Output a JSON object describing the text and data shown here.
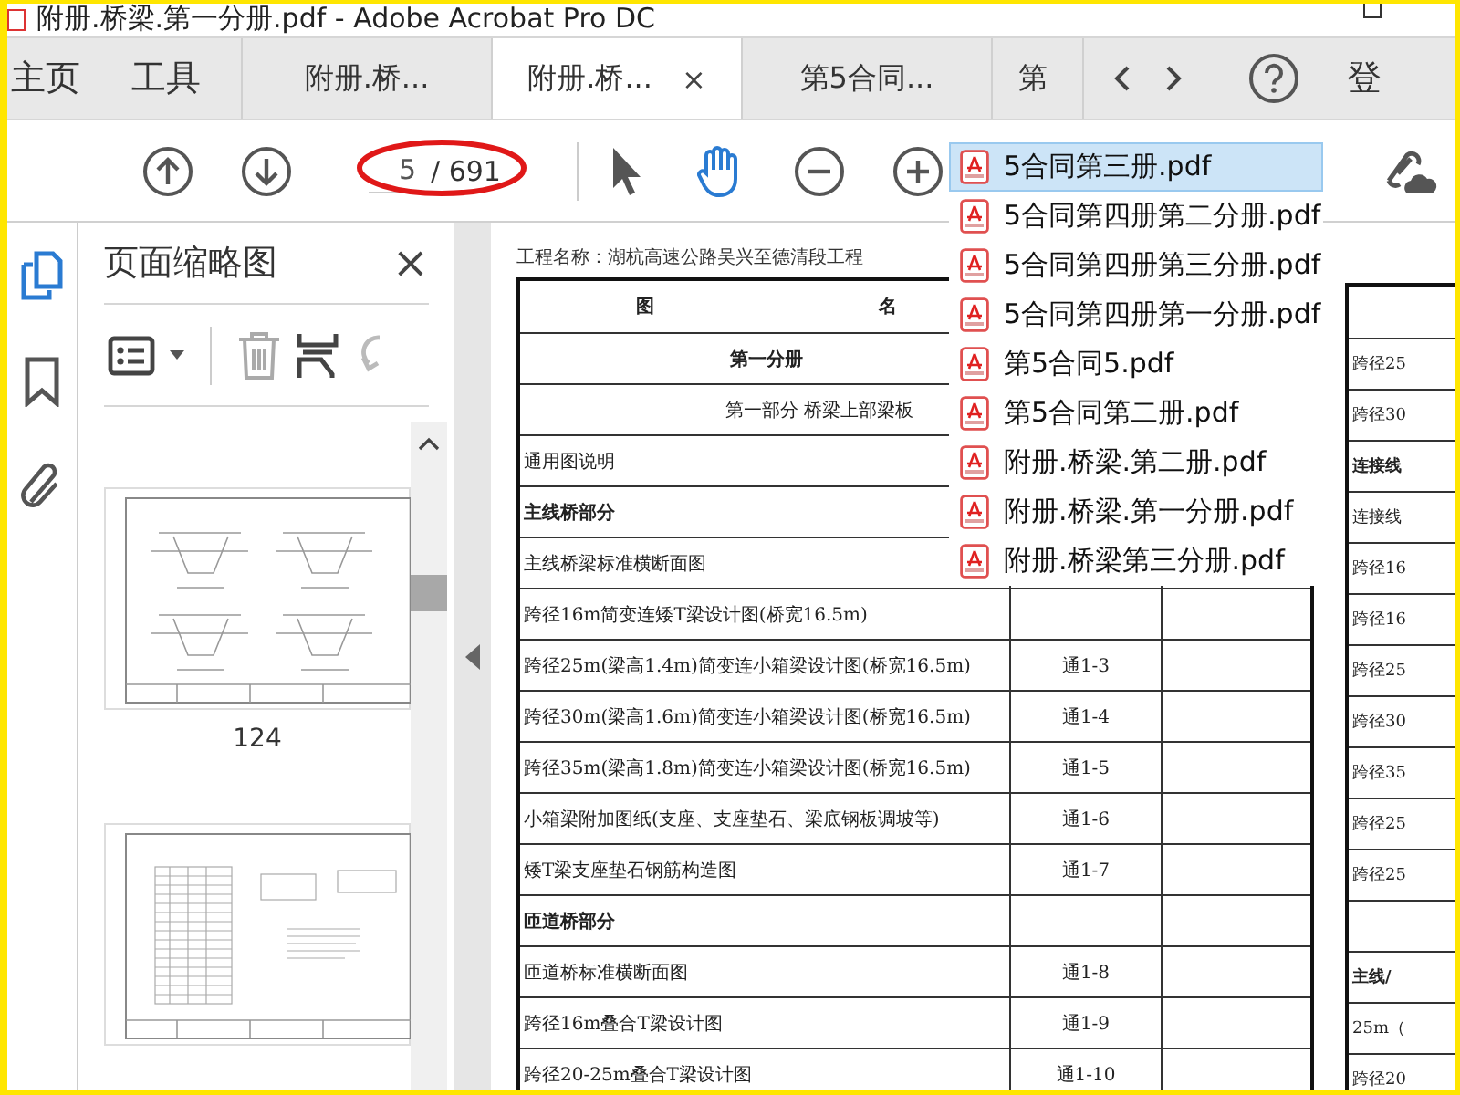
{
  "window": {
    "title": "附册.桥梁.第一分册.pdf - Adobe Acrobat Pro DC"
  },
  "tabs": [
    {
      "label": "主页",
      "kind": "nav",
      "selected": false
    },
    {
      "label": "工具",
      "kind": "nav",
      "selected": false
    },
    {
      "label": "附册.桥...",
      "kind": "doc",
      "selected": false
    },
    {
      "label": "附册.桥...",
      "kind": "doc",
      "selected": true,
      "close": "×"
    },
    {
      "label": "第5合同...",
      "kind": "doc",
      "selected": false
    },
    {
      "label": "第",
      "kind": "doc",
      "selected": false
    }
  ],
  "account": {
    "label": "登"
  },
  "toolbar": {
    "page": "5",
    "total": "/ 691",
    "tools": [
      {
        "kind": "select",
        "selected": false
      },
      {
        "kind": "hand",
        "selected": true
      }
    ]
  },
  "rail": [
    {
      "kind": "thumbnails",
      "selected": true
    },
    {
      "kind": "bookmarks",
      "selected": false
    },
    {
      "kind": "attachments",
      "selected": false
    }
  ],
  "thumbnail_pane": {
    "title": "页面缩略图",
    "close": "×",
    "thumbnails": [
      {
        "kind": "drawing",
        "label": "124"
      },
      {
        "kind": "table"
      }
    ]
  },
  "document": {
    "header": "工程名称：湖杭高速公路吴兴至德清段工程",
    "columns": [
      "图",
      "名"
    ],
    "rows": [
      {
        "kind": "volume",
        "name": "第一分册"
      },
      {
        "kind": "part",
        "name": "第一部分 桥梁上部梁板"
      },
      {
        "kind": "item",
        "name": "通用图说明"
      },
      {
        "kind": "section",
        "name": "主线桥部分"
      },
      {
        "kind": "item",
        "name": "主线桥梁标准横断面图"
      },
      {
        "kind": "item",
        "name": "跨径16m简变连矮T梁设计图(桥宽16.5m)"
      },
      {
        "kind": "item",
        "name": "跨径25m(梁高1.4m)简变连小箱梁设计图(桥宽16.5m)",
        "code": "通1-3"
      },
      {
        "kind": "item",
        "name": "跨径30m(梁高1.6m)简变连小箱梁设计图(桥宽16.5m)",
        "code": "通1-4"
      },
      {
        "kind": "item",
        "name": "跨径35m(梁高1.8m)简变连小箱梁设计图(桥宽16.5m)",
        "code": "通1-5"
      },
      {
        "kind": "item",
        "name": "小箱梁附加图纸(支座、支座垫石、梁底钢板调坡等)",
        "code": "通1-6"
      },
      {
        "kind": "item",
        "name": "矮T梁支座垫石钢筋构造图",
        "code": "通1-7"
      },
      {
        "kind": "section",
        "name": "匝道桥部分"
      },
      {
        "kind": "item",
        "name": "匝道桥标准横断面图",
        "code": "通1-8"
      },
      {
        "kind": "item",
        "name": "跨径16m叠合T梁设计图",
        "code": "通1-9"
      },
      {
        "kind": "item",
        "name": "跨径20-25m叠合T梁设计图",
        "code": "通1-10"
      }
    ],
    "next_page_rows": [
      {
        "kind": "item",
        "text": "跨径25"
      },
      {
        "kind": "item",
        "text": "跨径30"
      },
      {
        "kind": "section",
        "text": "连接线"
      },
      {
        "kind": "item",
        "text": "连接线"
      },
      {
        "kind": "item",
        "text": "跨径16"
      },
      {
        "kind": "item",
        "text": "跨径16"
      },
      {
        "kind": "item",
        "text": "跨径25"
      },
      {
        "kind": "item",
        "text": "跨径30"
      },
      {
        "kind": "item",
        "text": "跨径35"
      },
      {
        "kind": "item",
        "text": "跨径25"
      },
      {
        "kind": "item",
        "text": "跨径25"
      },
      {
        "kind": "blank"
      },
      {
        "kind": "section",
        "text": "主线/"
      },
      {
        "kind": "item",
        "text": "25m（"
      },
      {
        "kind": "item",
        "text": "跨径20"
      }
    ]
  },
  "file_menu": {
    "items": [
      {
        "label": "5合同第三册.pdf",
        "selected": true
      },
      {
        "label": "5合同第四册第二分册.pdf",
        "selected": false
      },
      {
        "label": "5合同第四册第三分册.pdf",
        "selected": false
      },
      {
        "label": "5合同第四册第一分册.pdf",
        "selected": false
      },
      {
        "label": "第5合同5.pdf",
        "selected": false
      },
      {
        "label": "第5合同第二册.pdf",
        "selected": false
      },
      {
        "label": "附册.桥梁.第二册.pdf",
        "selected": false
      },
      {
        "label": "附册.桥梁.第一分册.pdf",
        "selected": false
      },
      {
        "label": "附册.桥梁第三分册.pdf",
        "selected": false
      }
    ]
  }
}
